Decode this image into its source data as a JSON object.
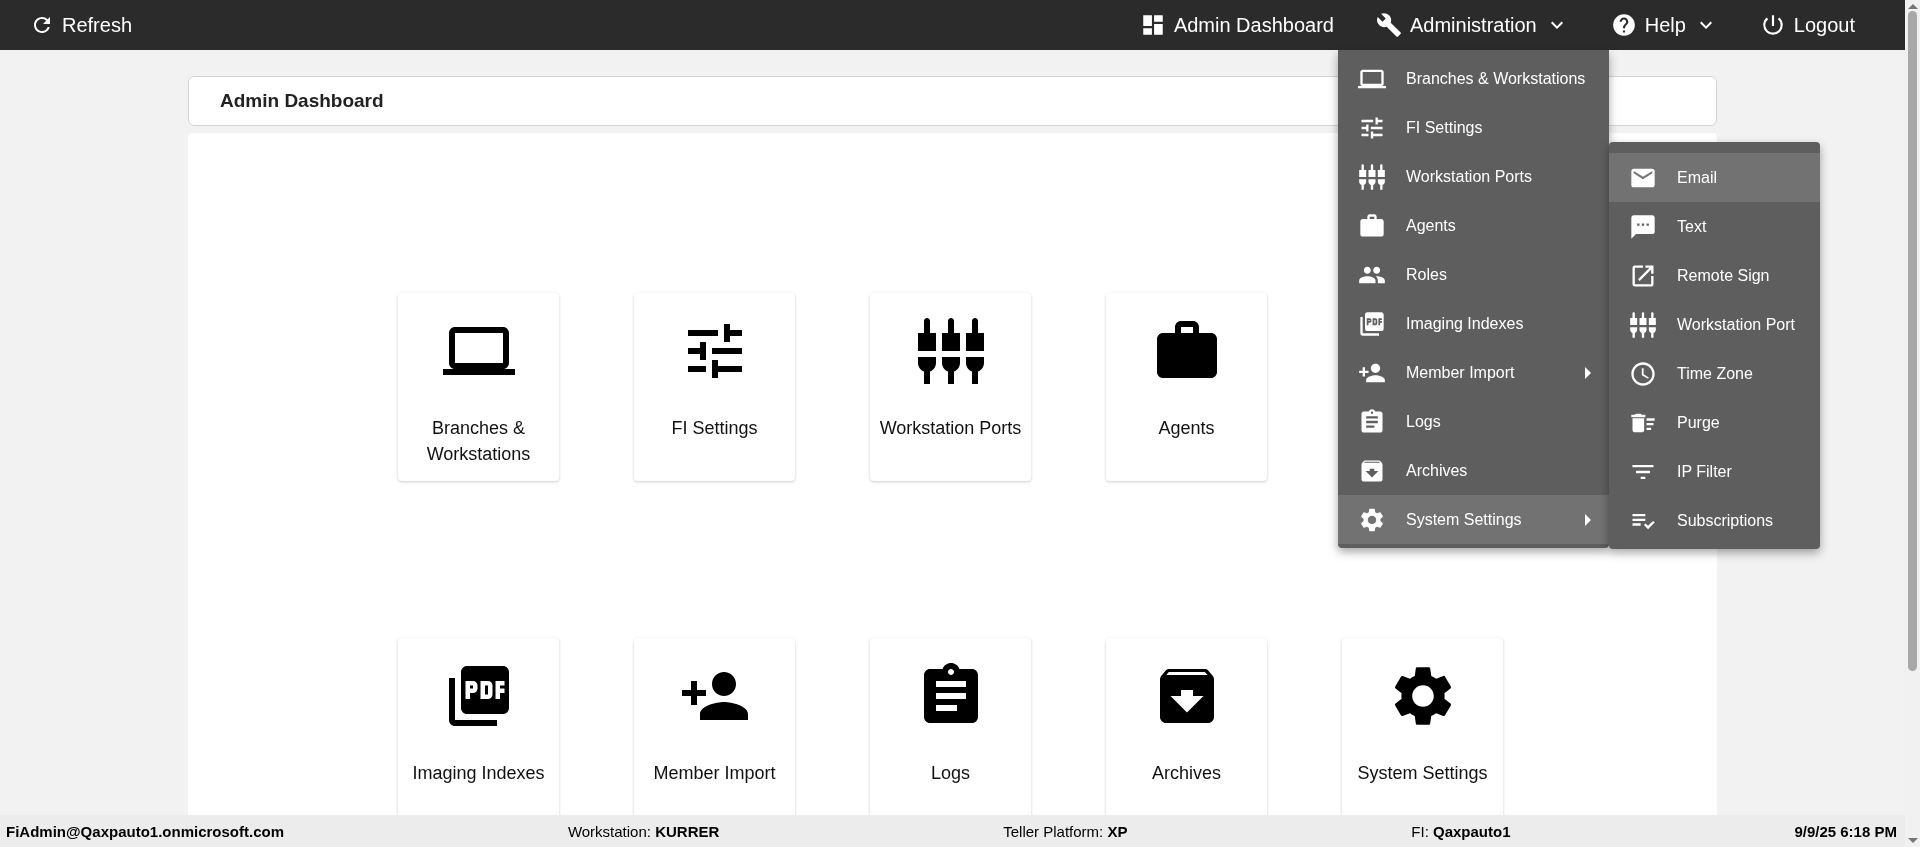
{
  "top_bar": {
    "left": {
      "label": "Refresh"
    },
    "items": [
      {
        "label": "Admin Dashboard",
        "dropdown": false
      },
      {
        "label": "Administration",
        "dropdown": true
      },
      {
        "label": "Help",
        "dropdown": true
      },
      {
        "label": "Logout",
        "dropdown": false
      }
    ]
  },
  "header": {
    "title": "Admin Dashboard"
  },
  "tile_rows": [
    [
      {
        "label": "Branches & Workstations"
      },
      {
        "label": "FI Settings"
      },
      {
        "label": "Workstation Ports"
      },
      {
        "label": "Agents"
      }
    ],
    [
      {
        "label": "Imaging Indexes"
      },
      {
        "label": "Member Import"
      },
      {
        "label": "Logs"
      },
      {
        "label": "Archives"
      },
      {
        "label": "System Settings"
      }
    ]
  ],
  "admin_menu": [
    {
      "label": "Branches & Workstations",
      "submenu": false,
      "expanded": false
    },
    {
      "label": "FI Settings",
      "submenu": false,
      "expanded": false
    },
    {
      "label": "Workstation Ports",
      "submenu": false,
      "expanded": false
    },
    {
      "label": "Agents",
      "submenu": false,
      "expanded": false
    },
    {
      "label": "Roles",
      "submenu": false,
      "expanded": false
    },
    {
      "label": "Imaging Indexes",
      "submenu": false,
      "expanded": false
    },
    {
      "label": "Member Import",
      "submenu": true,
      "expanded": false
    },
    {
      "label": "Logs",
      "submenu": false,
      "expanded": false
    },
    {
      "label": "Archives",
      "submenu": false,
      "expanded": false
    },
    {
      "label": "System Settings",
      "submenu": true,
      "expanded": true
    }
  ],
  "system_settings_menu": [
    {
      "label": "Email",
      "selected": true
    },
    {
      "label": "Text",
      "selected": false
    },
    {
      "label": "Remote Sign",
      "selected": false
    },
    {
      "label": "Workstation Port",
      "selected": false
    },
    {
      "label": "Time Zone",
      "selected": false
    },
    {
      "label": "Purge",
      "selected": false
    },
    {
      "label": "IP Filter",
      "selected": false
    },
    {
      "label": "Subscriptions",
      "selected": false
    }
  ],
  "status_bar": {
    "user": "FiAdmin@Qaxpauto1.onmicrosoft.com",
    "workstation": "Workstation: **KURRER**",
    "platform": "Teller Platform: **XP**",
    "fi": "FI: **Qaxpauto1**",
    "datetime": "9/9/25 6:18 PM"
  }
}
